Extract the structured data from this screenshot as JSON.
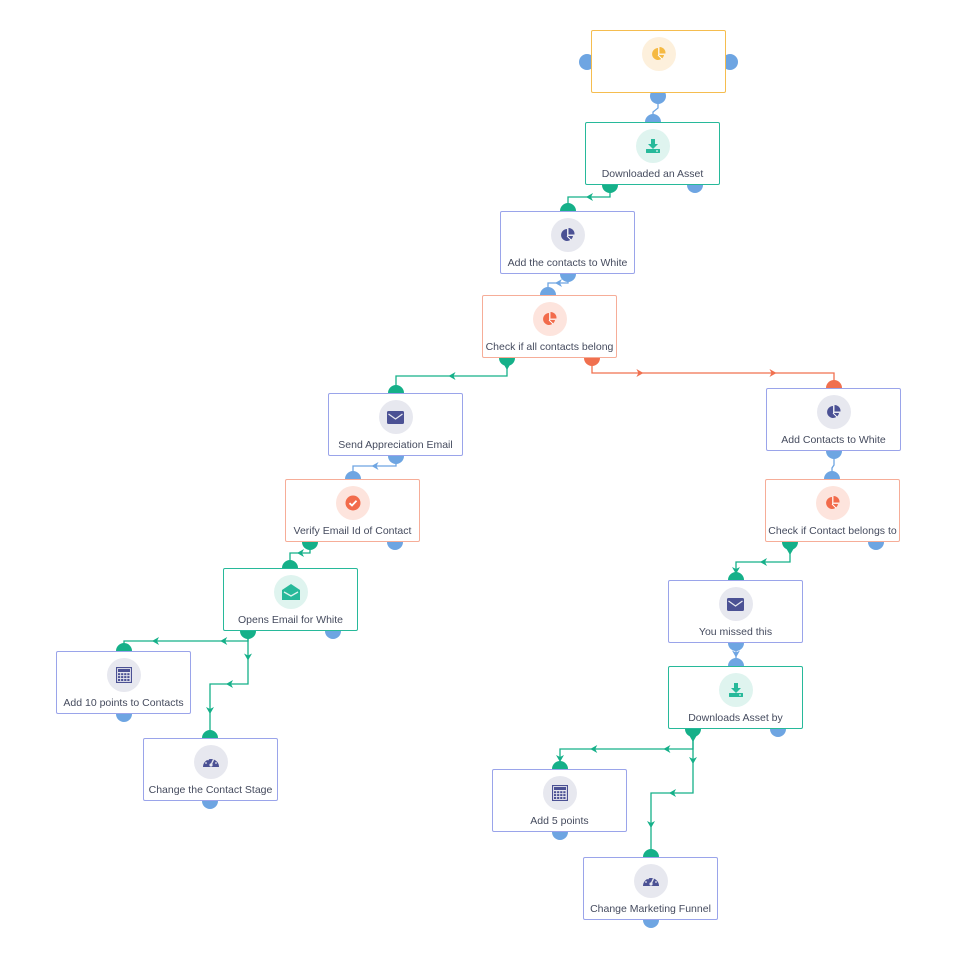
{
  "colors": {
    "connector_blue": "#6ea5e2",
    "connector_green": "#15b089",
    "connector_orange": "#f0704f",
    "yellow": "#f5b942",
    "teal": "#27b99a",
    "navy": "#4b5194",
    "salmon": "#f26b4b"
  },
  "nodes": [
    {
      "id": "n1",
      "label": "",
      "icon": "pie-chart-icon",
      "variant": "yellow"
    },
    {
      "id": "n2",
      "label": "Downloaded an Asset",
      "icon": "download-icon",
      "variant": "teal"
    },
    {
      "id": "n3",
      "label": "Add the contacts to White",
      "icon": "pie-chart-icon",
      "variant": "purple"
    },
    {
      "id": "n4",
      "label": "Check if all contacts belong",
      "icon": "pie-chart-icon",
      "variant": "salmon"
    },
    {
      "id": "n5",
      "label": "Send Appreciation Email",
      "icon": "envelope-icon",
      "variant": "purple"
    },
    {
      "id": "n6",
      "label": "Verify Email Id of Contact",
      "icon": "check-circle-icon",
      "variant": "salmon"
    },
    {
      "id": "n7",
      "label": "Opens Email for White",
      "icon": "open-envelope-icon",
      "variant": "teal"
    },
    {
      "id": "n8",
      "label": "Add 10 points to Contacts",
      "icon": "calculator-icon",
      "variant": "purple"
    },
    {
      "id": "n9",
      "label": "Change the Contact Stage",
      "icon": "gauge-icon",
      "variant": "purple"
    },
    {
      "id": "n10",
      "label": "Add Contacts to White",
      "icon": "pie-chart-icon",
      "variant": "purple"
    },
    {
      "id": "n11",
      "label": "Check if Contact belongs to",
      "icon": "pie-chart-icon",
      "variant": "salmon"
    },
    {
      "id": "n12",
      "label": "You missed this",
      "icon": "envelope-icon",
      "variant": "purple"
    },
    {
      "id": "n13",
      "label": "Downloads Asset by",
      "icon": "download-icon",
      "variant": "teal"
    },
    {
      "id": "n14",
      "label": "Add 5 points",
      "icon": "calculator-icon",
      "variant": "purple"
    },
    {
      "id": "n15",
      "label": "Change Marketing Funnel",
      "icon": "gauge-icon",
      "variant": "purple"
    }
  ]
}
